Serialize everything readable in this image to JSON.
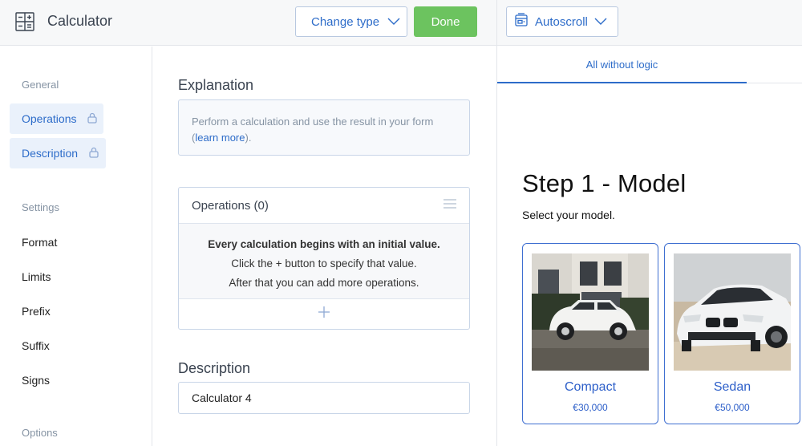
{
  "header": {
    "app_title": "Calculator",
    "change_type_label": "Change type",
    "done_label": "Done",
    "autoscroll_label": "Autoscroll"
  },
  "sidebar": {
    "general_heading": "General",
    "general_items": [
      {
        "label": "Operations",
        "locked": true,
        "active": true
      },
      {
        "label": "Description",
        "locked": true,
        "active": true
      }
    ],
    "settings_heading": "Settings",
    "settings_items": [
      {
        "label": "Format"
      },
      {
        "label": "Limits"
      },
      {
        "label": "Prefix"
      },
      {
        "label": "Suffix"
      },
      {
        "label": "Signs"
      }
    ],
    "options_heading": "Options"
  },
  "main": {
    "explanation_heading": "Explanation",
    "explanation_text": "Perform a calculation and use the result in your form (",
    "explanation_link": "learn more",
    "explanation_end": ").",
    "operations_title": "Operations (0)",
    "operations_line1": "Every calculation begins with an initial value.",
    "operations_line2": "Click the + button to specify that value.",
    "operations_line3": "After that you can add more operations.",
    "description_heading": "Description",
    "description_value": "Calculator 4"
  },
  "preview": {
    "tab_label": "All without logic",
    "step_title": "Step 1 - Model",
    "step_subtitle": "Select your model.",
    "cards": [
      {
        "label": "Compact",
        "price": "€30,000"
      },
      {
        "label": "Sedan",
        "price": "€50,000"
      }
    ]
  },
  "colors": {
    "accent": "#2d6cc9",
    "done_green": "#6cc35f",
    "sidebar_active_bg": "#eaf1fb",
    "card_border": "#3f6fd1"
  }
}
